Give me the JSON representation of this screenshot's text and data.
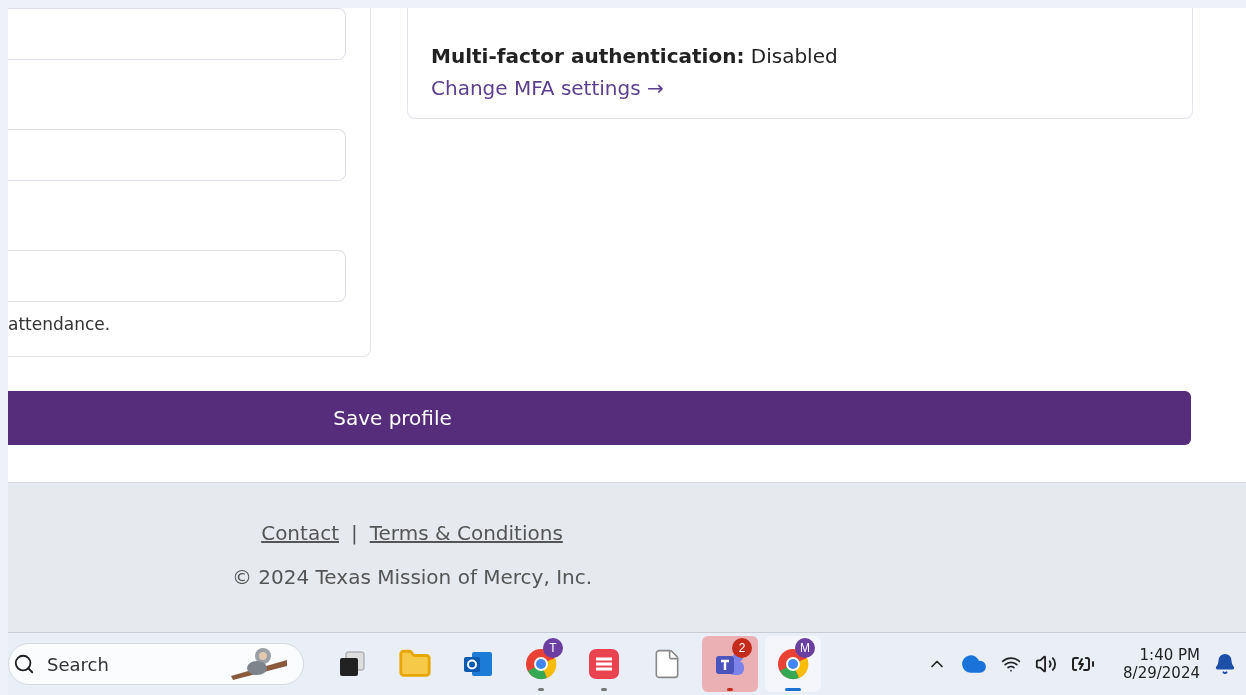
{
  "profile_form": {
    "fields": [
      {
        "kind": "text"
      },
      {
        "kind": "text"
      },
      {
        "kind": "text"
      }
    ],
    "helper_text": "attendance."
  },
  "security": {
    "mfa_label": "Multi-factor authentication:",
    "mfa_status": "Disabled",
    "mfa_link": "Change MFA settings →"
  },
  "save_button": "Save profile",
  "footer": {
    "links": [
      "Contact",
      "Terms & Conditions"
    ],
    "separator": "|",
    "copyright": "© 2024 Texas Mission of Mercy, Inc."
  },
  "taskbar": {
    "search": {
      "placeholder": "Search"
    },
    "apps": [
      {
        "kind": "taskview",
        "active": false,
        "running": false
      },
      {
        "kind": "folder",
        "active": false,
        "running": false
      },
      {
        "kind": "mail",
        "active": false,
        "running": false
      },
      {
        "kind": "browser",
        "badge": "T",
        "active": false,
        "running": true
      },
      {
        "kind": "slides",
        "active": false,
        "running": true
      },
      {
        "kind": "file",
        "active": false,
        "running": false
      },
      {
        "kind": "teams",
        "badge": "2",
        "active": true,
        "running": true
      },
      {
        "kind": "browser",
        "badge": "M",
        "active": false,
        "running": true,
        "focused": true
      }
    ],
    "time": "1:40 PM",
    "date": "8/29/2024"
  }
}
